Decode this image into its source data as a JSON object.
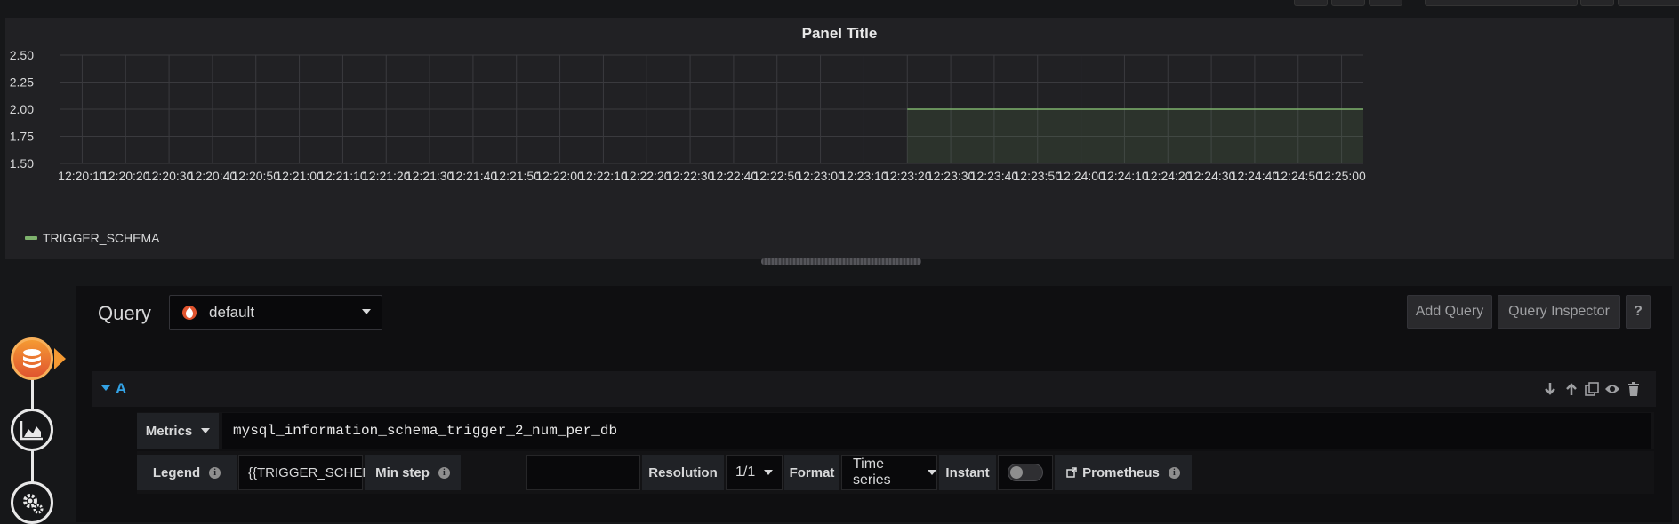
{
  "panel": {
    "title": "Panel Title",
    "legend": [
      {
        "name": "TRIGGER_SCHEMA",
        "color": "#7eb26d"
      }
    ]
  },
  "chart_data": {
    "type": "area",
    "y_ticks": [
      "2.50",
      "2.25",
      "2.00",
      "1.75",
      "1.50"
    ],
    "ylim": [
      1.5,
      2.5
    ],
    "x_ticks": [
      "12:20:10",
      "12:20:20",
      "12:20:30",
      "12:20:40",
      "12:20:50",
      "12:21:00",
      "12:21:10",
      "12:21:20",
      "12:21:30",
      "12:21:40",
      "12:21:50",
      "12:22:00",
      "12:22:10",
      "12:22:20",
      "12:22:30",
      "12:22:40",
      "12:22:50",
      "12:23:00",
      "12:23:10",
      "12:23:20",
      "12:23:30",
      "12:23:40",
      "12:23:50",
      "12:24:00",
      "12:24:10",
      "12:24:20",
      "12:24:30",
      "12:24:40",
      "12:24:50",
      "12:25:00"
    ],
    "xlim": [
      "12:20:05",
      "12:25:05"
    ],
    "grid": true,
    "legend_placement": "bottom-left",
    "series": [
      {
        "name": "TRIGGER_SCHEMA",
        "color": "#7eb26d",
        "x": [
          "12:23:20",
          "12:25:05"
        ],
        "values": [
          2,
          2
        ]
      }
    ]
  },
  "editor": {
    "query_label": "Query",
    "datasource": {
      "label": "default",
      "icon": "prometheus-icon",
      "color": "#e0542f"
    },
    "add_query_label": "Add Query",
    "query_inspector_label": "Query Inspector",
    "help_label": "?",
    "query_row": {
      "ref_id": "A"
    },
    "metrics": {
      "label": "Metrics",
      "value": "mysql_information_schema_trigger_2_num_per_db"
    },
    "options": {
      "legend_label": "Legend",
      "legend_value": "{{TRIGGER_SCHEMA}}",
      "min_step_label": "Min step",
      "min_step_value": "",
      "resolution_label": "Resolution",
      "resolution_value": "1/1",
      "format_label": "Format",
      "format_value": "Time series",
      "instant_label": "Instant",
      "instant_on": false,
      "prometheus_label": "Prometheus"
    }
  },
  "sidebar": {
    "items": [
      {
        "name": "queries",
        "icon": "database-icon",
        "active": true
      },
      {
        "name": "visualization",
        "icon": "area-chart-icon",
        "active": false
      },
      {
        "name": "general",
        "icon": "cogs-icon",
        "active": false
      }
    ]
  },
  "colors": {
    "accent_blue": "#33a2e5",
    "accent_orange": "#f59a33",
    "series_green": "#7eb26d"
  }
}
